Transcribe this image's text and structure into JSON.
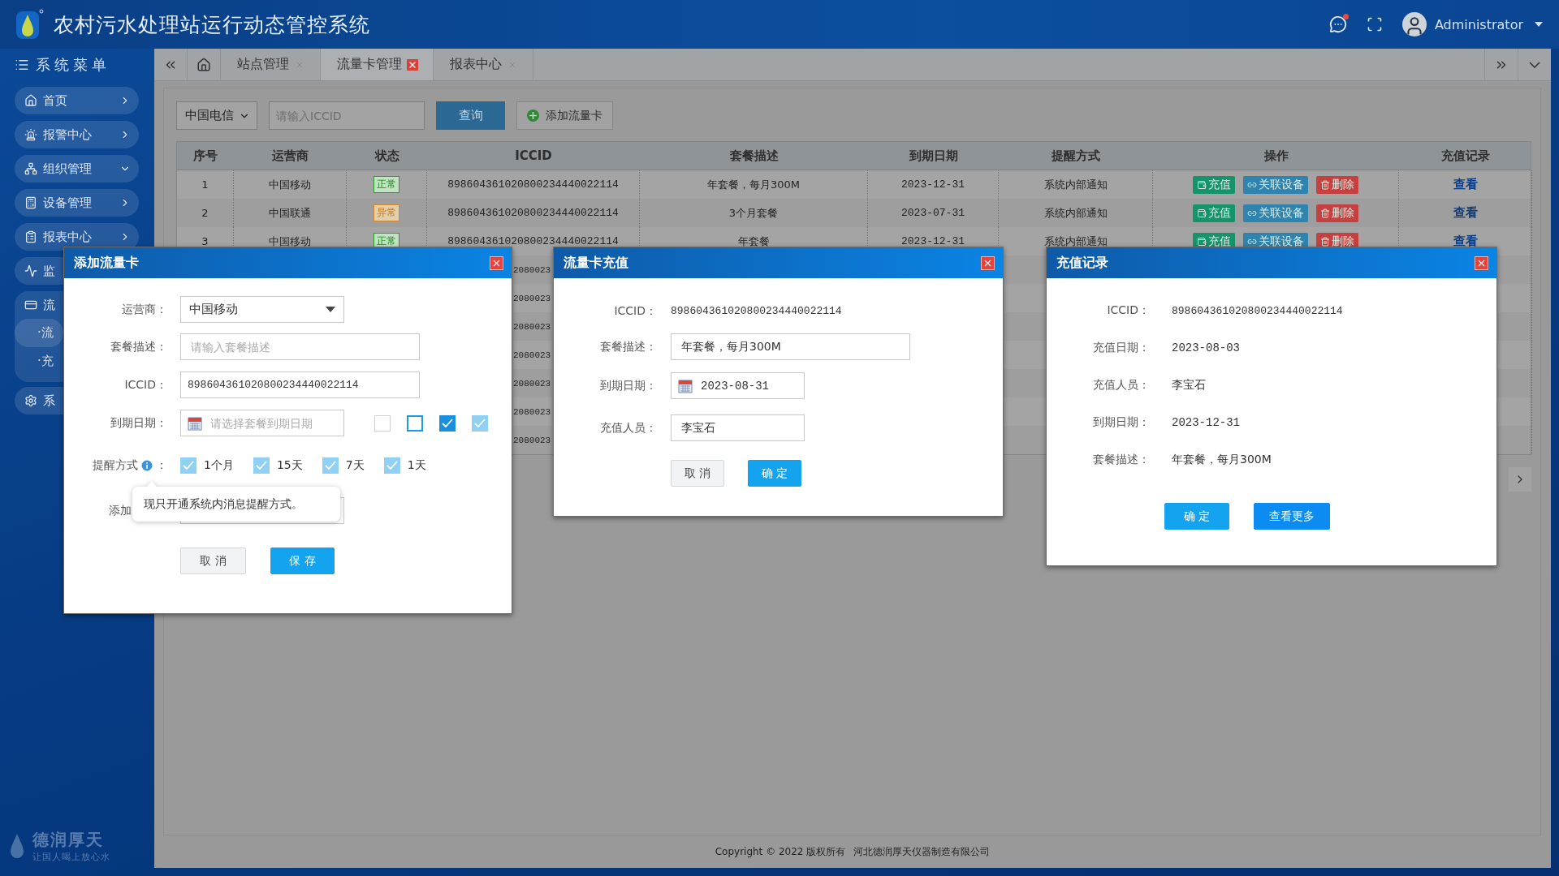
{
  "header": {
    "title": "农村污水处理站运行动态管控系统",
    "user": "Administrator"
  },
  "sidebar": {
    "title": "系统菜单",
    "items": [
      {
        "label": "首页",
        "expanded": false
      },
      {
        "label": "报警中心",
        "expanded": false
      },
      {
        "label": "组织管理",
        "expanded": true
      },
      {
        "label": "设备管理",
        "expanded": false
      },
      {
        "label": "报表中心",
        "expanded": false
      },
      {
        "label": "监"
      },
      {
        "label": "流",
        "children": [
          {
            "label": "·流",
            "selected": true
          },
          {
            "label": "·充",
            "selected": false
          }
        ]
      },
      {
        "label": "系"
      }
    ],
    "brand": {
      "name": "德润厚天",
      "slogan": "让国人喝上放心水"
    }
  },
  "tabs": [
    {
      "label": "站点管理",
      "selected": false
    },
    {
      "label": "流量卡管理",
      "selected": true
    },
    {
      "label": "报表中心",
      "selected": false
    }
  ],
  "toolbar": {
    "carrier": "中国电信",
    "search_placeholder": "请输入ICCID",
    "query": "查询",
    "add": "添加流量卡"
  },
  "table": {
    "columns": [
      "序号",
      "运营商",
      "状态",
      "ICCID",
      "套餐描述",
      "到期日期",
      "提醒方式",
      "操作",
      "充值记录"
    ],
    "rows": [
      {
        "no": "1",
        "carrier": "中国移动",
        "status": {
          "label": "正常",
          "kind": "ok"
        },
        "iccid": "898604361020800234440022114",
        "plan": "年套餐，每月300M",
        "expiry": "2023-12-31",
        "reminder": "系统内部通知",
        "actions": [
          {
            "label": "充值",
            "kind": "recharge"
          },
          {
            "label": "关联设备",
            "kind": "link"
          },
          {
            "label": "删除",
            "kind": "delete"
          }
        ],
        "record": "查看"
      },
      {
        "no": "2",
        "carrier": "中国联通",
        "status": {
          "label": "异常",
          "kind": "error"
        },
        "iccid": "898604361020800234440022114",
        "plan": "3个月套餐",
        "expiry": "2023-07-31",
        "reminder": "系统内部通知",
        "actions": [
          {
            "label": "充值",
            "kind": "recharge"
          },
          {
            "label": "关联设备",
            "kind": "link"
          },
          {
            "label": "删除",
            "kind": "delete"
          }
        ],
        "record": "查看"
      },
      {
        "no": "3",
        "carrier": "中国移动",
        "status": {
          "label": "正常",
          "kind": "ok"
        },
        "iccid": "898604361020800234440022114",
        "plan": "年套餐",
        "expiry": "2023-12-31",
        "reminder": "系统内部通知",
        "actions": [
          {
            "label": "充值",
            "kind": "recharge"
          },
          {
            "label": "关联设备",
            "kind": "link"
          },
          {
            "label": "删除",
            "kind": "delete"
          }
        ],
        "record": "查看"
      }
    ],
    "covered_rows": [
      {
        "iccid_part": "2080023"
      },
      {
        "iccid_part": "2080023"
      },
      {
        "iccid_part": "2080023"
      },
      {
        "iccid_part": "2080023"
      },
      {
        "iccid_part": "2080023"
      },
      {
        "iccid_part": "2080023"
      },
      {
        "iccid_part": "2080023"
      }
    ]
  },
  "footer": {
    "copyright": "Copyright © 2022 版权所有",
    "company": "河北德润厚天仪器制造有限公司"
  },
  "add_dialog": {
    "title": "添加流量卡",
    "carrier": {
      "label": "运营商：",
      "value": "中国移动"
    },
    "plan": {
      "label": "套餐描述：",
      "placeholder": "请输入套餐描述"
    },
    "iccid": {
      "label": "ICCID：",
      "value": "898604361020800234440022114"
    },
    "expiry": {
      "label": "到期日期：",
      "placeholder": "请选择套餐到期日期"
    },
    "samples": [
      {
        "kind": "normal",
        "checked": false
      },
      {
        "kind": "hover",
        "checked": false
      },
      {
        "kind": "normal",
        "checked": true
      },
      {
        "kind": "disabled",
        "checked": true
      }
    ],
    "reminder": {
      "label": "提醒方式",
      "suffix": "：",
      "options": [
        {
          "label": "1个月",
          "checked": true,
          "disabled": true
        },
        {
          "label": "15天",
          "checked": true,
          "disabled": true
        },
        {
          "label": "7天",
          "checked": true,
          "disabled": true
        },
        {
          "label": "1天",
          "checked": true,
          "disabled": true
        }
      ],
      "tooltip": "现只开通系统内消息提醒方式。"
    },
    "adder": {
      "label": "添加"
    },
    "buttons": [
      {
        "label": "取 消",
        "kind": "secondary"
      },
      {
        "label": "保 存",
        "kind": "primary"
      }
    ]
  },
  "recharge_dialog": {
    "title": "流量卡充值",
    "iccid": {
      "label": "ICCID：",
      "value": "898604361020800234440022114"
    },
    "plan": {
      "label": "套餐描述：",
      "value": "年套餐，每月300M"
    },
    "expiry": {
      "label": "到期日期：",
      "value": "2023-08-31"
    },
    "operator": {
      "label": "充值人员：",
      "value": "李宝石"
    },
    "buttons": [
      {
        "label": "取 消",
        "kind": "secondary"
      },
      {
        "label": "确 定",
        "kind": "primary"
      }
    ]
  },
  "record_dialog": {
    "title": "充值记录",
    "fields": [
      {
        "label": "ICCID：",
        "value": "898604361020800234440022114"
      },
      {
        "label": "充值日期：",
        "value": "2023-08-03"
      },
      {
        "label": "充值人员：",
        "value": "李宝石"
      },
      {
        "label": "到期日期：",
        "value": "2023-12-31"
      },
      {
        "label": "套餐描述：",
        "value": "年套餐，每月300M"
      }
    ],
    "buttons": [
      {
        "label": "确 定",
        "kind": "primary"
      },
      {
        "label": "查看更多",
        "kind": "accent"
      }
    ]
  }
}
